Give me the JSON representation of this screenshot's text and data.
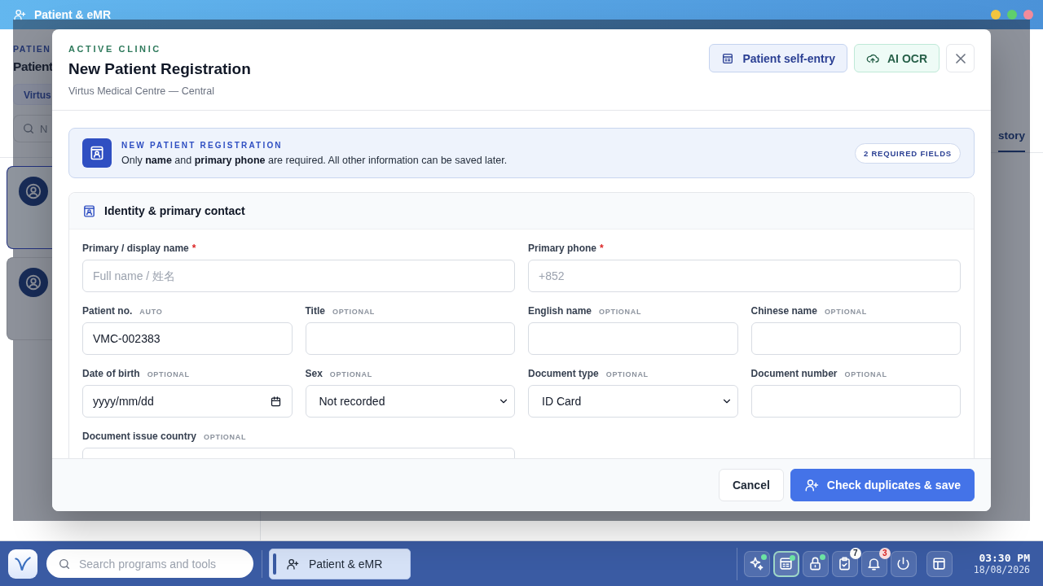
{
  "app": {
    "title": "Patient & eMR"
  },
  "background": {
    "eyebrow": "PATIEN",
    "heading": "Patient",
    "clinic_chip": "Virtus",
    "search": {
      "placeholder": "N"
    },
    "patients": [
      {
        "selected": true
      },
      {
        "selected": false
      }
    ],
    "tab": "story"
  },
  "modal": {
    "eyebrow": "ACTIVE CLINIC",
    "title": "New Patient Registration",
    "subtitle": "Virtus Medical Centre — Central",
    "actions": [
      {
        "kind": "self-entry",
        "label": "Patient self-entry"
      },
      {
        "kind": "ocr",
        "label": "AI OCR"
      },
      {
        "kind": "close"
      }
    ],
    "banner": {
      "title": "NEW PATIENT REGISTRATION",
      "text": "Only **name** and **primary phone** are required. All other information can be saved later.",
      "badge": "2 REQUIRED FIELDS"
    },
    "section": {
      "title": "Identity & primary contact",
      "fields": [
        {
          "label": "Primary / display name",
          "mark": "*",
          "kind": "text",
          "wide": true,
          "placeholder": "Full name / 姓名"
        },
        {
          "label": "Primary phone",
          "mark": "*",
          "kind": "text",
          "wide": true,
          "placeholder": "+852"
        },
        {
          "label": "Patient no.",
          "hint": "AUTO",
          "kind": "text",
          "value": "VMC-002383"
        },
        {
          "label": "Title",
          "hint": "OPTIONAL",
          "kind": "text"
        },
        {
          "label": "English name",
          "hint": "OPTIONAL",
          "kind": "text"
        },
        {
          "label": "Chinese name",
          "hint": "OPTIONAL",
          "kind": "text"
        },
        {
          "label": "Date of birth",
          "hint": "OPTIONAL",
          "kind": "date",
          "placeholder": "yyyy/mm/dd"
        },
        {
          "label": "Sex",
          "hint": "OPTIONAL",
          "kind": "select",
          "value": "Not recorded"
        },
        {
          "label": "Document type",
          "hint": "OPTIONAL",
          "kind": "select",
          "value": "ID Card"
        },
        {
          "label": "Document number",
          "hint": "OPTIONAL",
          "kind": "text"
        },
        {
          "label": "Document issue country",
          "hint": "OPTIONAL",
          "kind": "text",
          "wide": true
        }
      ]
    },
    "footer": {
      "buttons": [
        {
          "label": "Cancel",
          "primary": false
        },
        {
          "label": "Check duplicates & save",
          "primary": true
        }
      ]
    }
  },
  "taskbar": {
    "search": {
      "placeholder": "Search programs and tools"
    },
    "app": {
      "label": "Patient & eMR",
      "selected": true
    },
    "tray": [
      {
        "kind": "sparkle",
        "selected": false,
        "dot": true
      },
      {
        "kind": "card",
        "selected": true,
        "dot": true
      },
      {
        "kind": "lock",
        "selected": false,
        "dot": true
      },
      {
        "kind": "clipboard",
        "selected": false,
        "dot": false,
        "badge": "7",
        "alert": false
      },
      {
        "kind": "bell",
        "selected": false,
        "dot": false,
        "badge": "3",
        "alert": true
      },
      {
        "kind": "power",
        "selected": false,
        "dot": false
      },
      {
        "kind": "layout",
        "selected": false,
        "dot": false
      }
    ],
    "clock": {
      "time": "03:30 PM",
      "date": "18/08/2026"
    }
  }
}
